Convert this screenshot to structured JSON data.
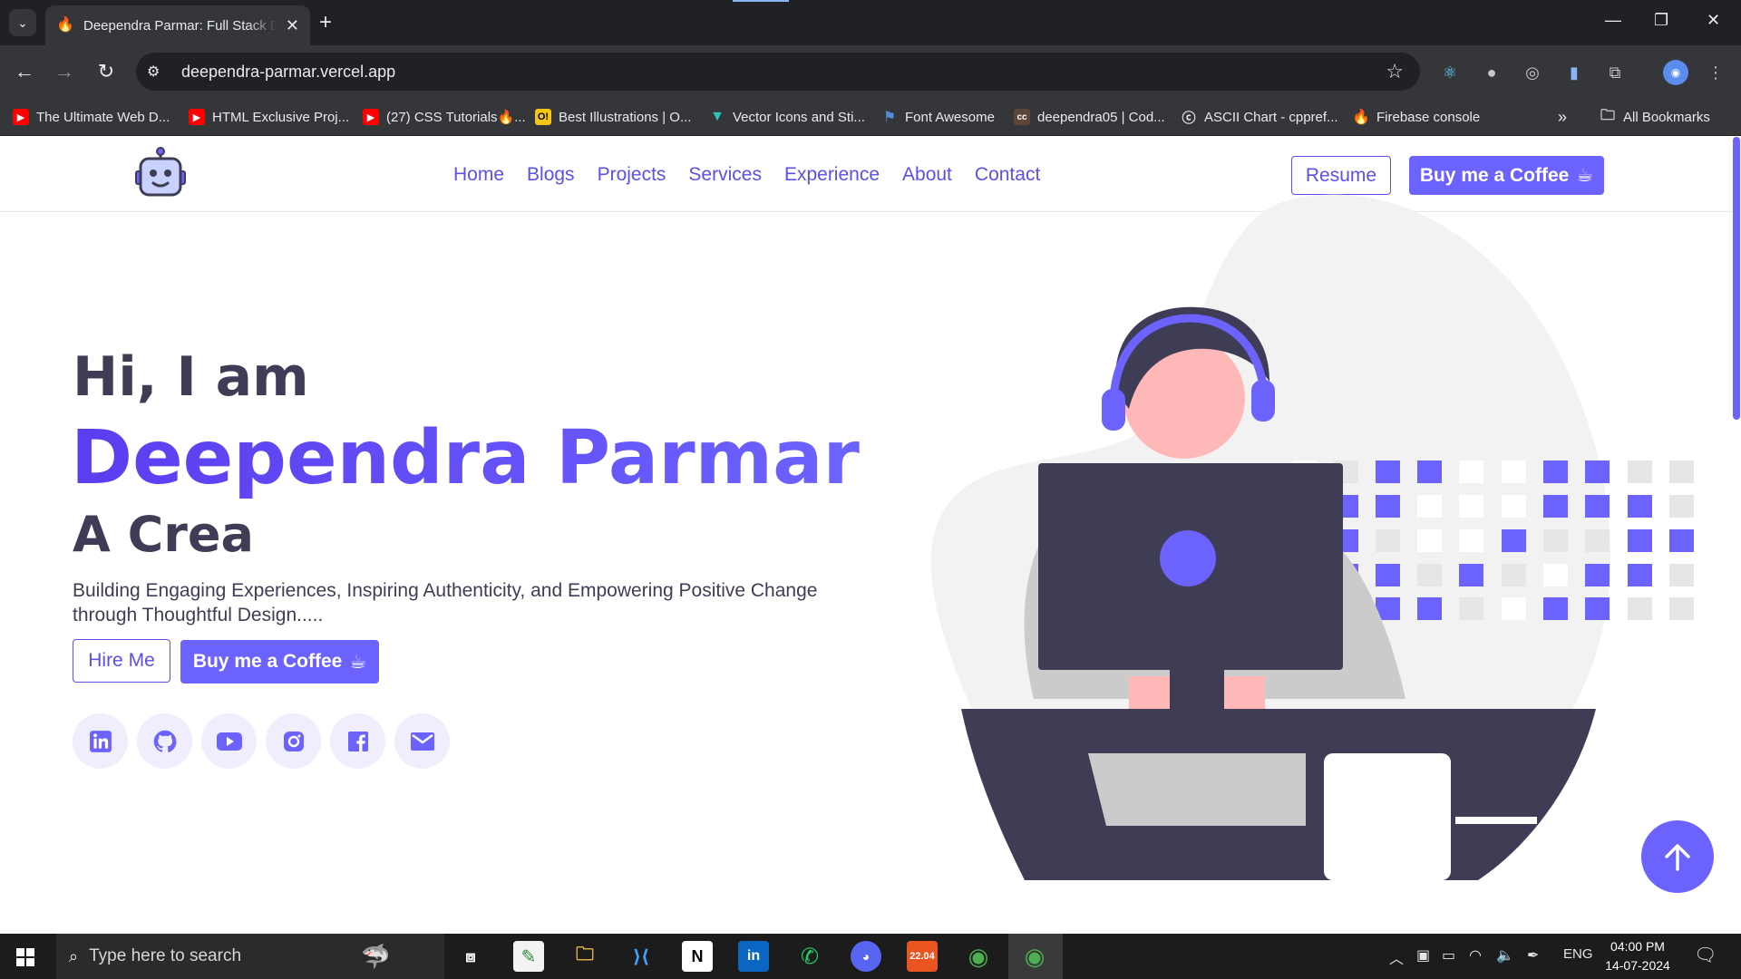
{
  "browser": {
    "tab_title": "Deependra Parmar: Full Stack D",
    "url": "deependra-parmar.vercel.app",
    "bookmarks": [
      {
        "label": "The Ultimate Web D...",
        "icon": "youtube-icon"
      },
      {
        "label": "HTML Exclusive Proj...",
        "icon": "youtube-icon"
      },
      {
        "label": "(27) CSS Tutorials🔥...",
        "icon": "youtube-icon"
      },
      {
        "label": "Best Illustrations | O...",
        "icon": "oi-icon"
      },
      {
        "label": "Vector Icons and Sti...",
        "icon": "vector-icon"
      },
      {
        "label": "Font Awesome",
        "icon": "flag-icon"
      },
      {
        "label": "deependra05 | Cod...",
        "icon": "codechef-icon"
      },
      {
        "label": "ASCII Chart - cppref...",
        "icon": "cppref-icon"
      },
      {
        "label": "Firebase console",
        "icon": "firebase-icon"
      }
    ],
    "all_bookmarks": "All Bookmarks"
  },
  "site": {
    "nav": [
      "Home",
      "Blogs",
      "Projects",
      "Services",
      "Experience",
      "About",
      "Contact"
    ],
    "resume_label": "Resume",
    "coffee_label": "Buy me a Coffee",
    "coffee_emoji": "☕"
  },
  "hero": {
    "greeting": "Hi, I am",
    "name": "Deependra Parmar",
    "typed_role": "A Crea",
    "description": "Building Engaging Experiences, Inspiring Authenticity, and Empowering Positive Change through Thoughtful Design.....",
    "hire_label": "Hire Me",
    "coffee_label": "Buy me a Coffee",
    "socials": [
      "linkedin-icon",
      "github-icon",
      "youtube-icon",
      "instagram-icon",
      "facebook-icon",
      "mail-icon"
    ]
  },
  "taskbar": {
    "search_placeholder": "Type here to search",
    "language": "ENG",
    "time": "04:00 PM",
    "date": "14-07-2024"
  },
  "colors": {
    "accent": "#6c63ff",
    "dark": "#3f3d56"
  }
}
